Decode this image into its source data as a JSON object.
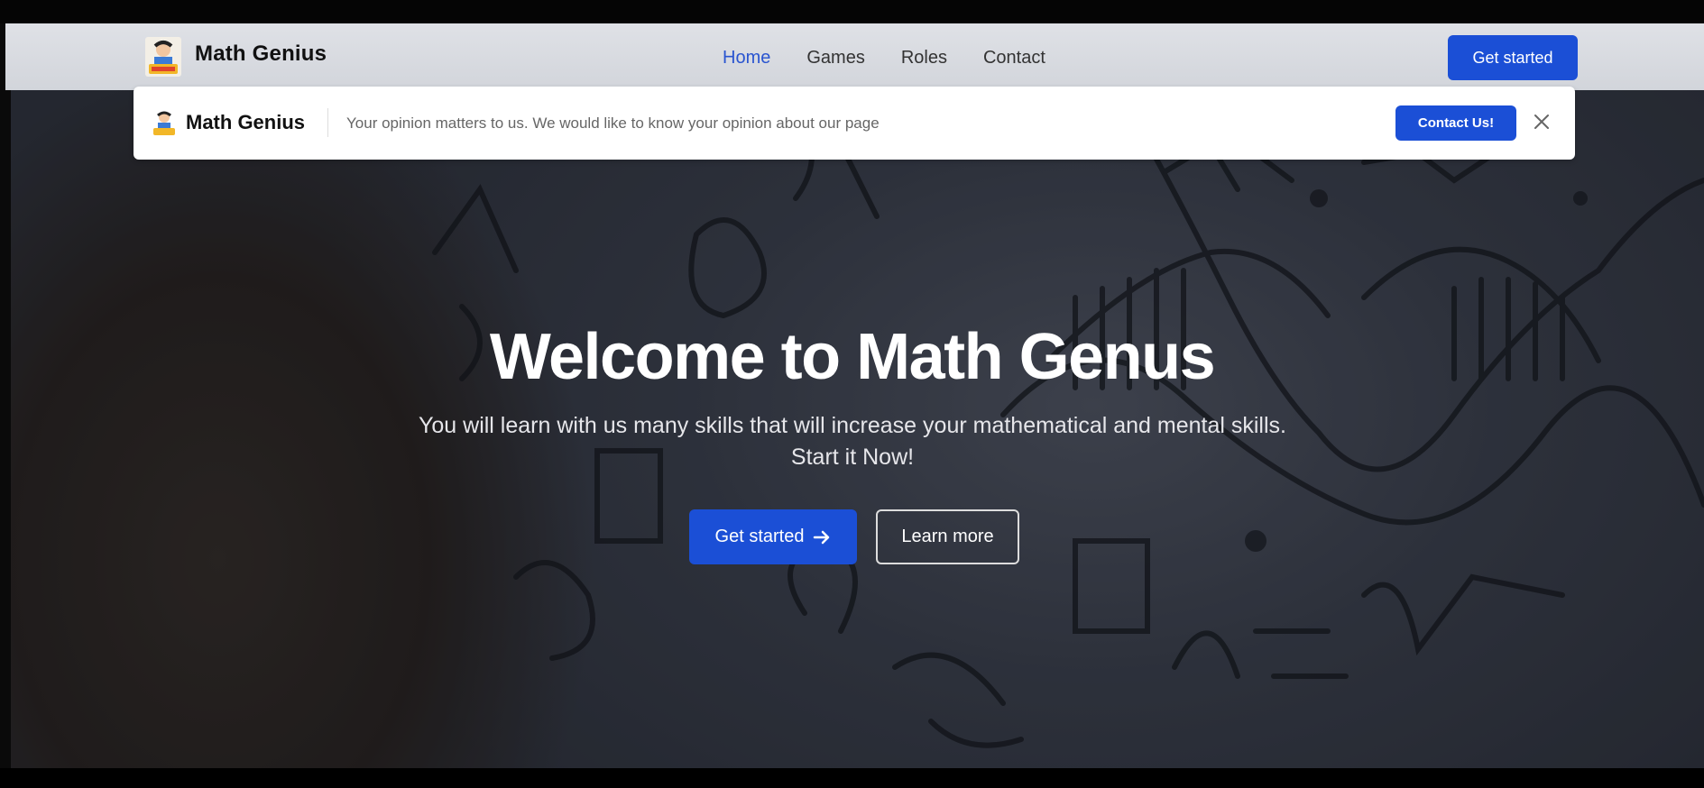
{
  "nav": {
    "brand": "Math Genius",
    "links": [
      "Home",
      "Games",
      "Roles",
      "Contact"
    ],
    "cta": "Get started",
    "accent": "#1b4fd6",
    "active_color": "#2a55d0"
  },
  "banner": {
    "brand": "Math Genius",
    "message": "Your opinion matters to us. We would like to know your opinion about our page",
    "cta": "Contact Us!",
    "close_icon": "close-icon"
  },
  "hero": {
    "title": "Welcome to Math Genus",
    "subtitle_line1": "You will learn with us many skills that will increase your mathematical and mental skills.",
    "subtitle_line2": "Start it Now!",
    "primary_btn": "Get started",
    "primary_icon": "arrow-right-icon",
    "secondary_btn": "Learn more"
  }
}
